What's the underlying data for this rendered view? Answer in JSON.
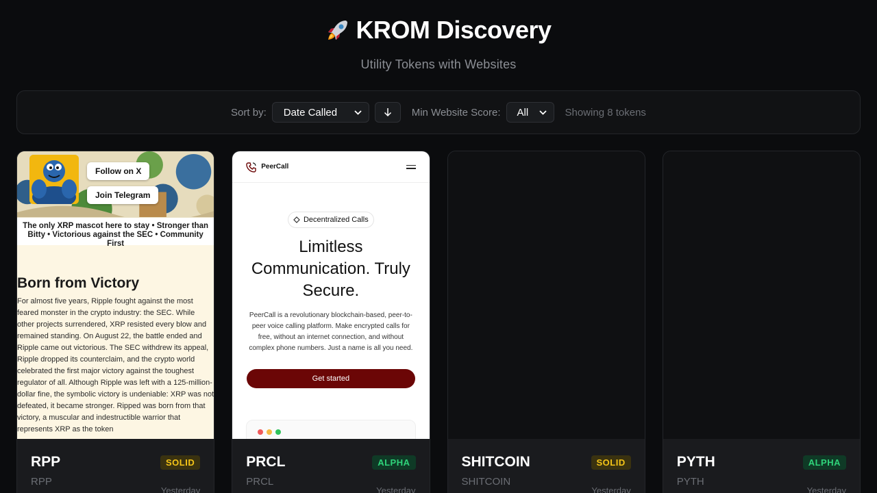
{
  "header": {
    "title": "KROM Discovery",
    "subtitle": "Utility Tokens with Websites"
  },
  "controls": {
    "sort_label": "Sort by:",
    "sort_value": "Date Called",
    "sort_direction_icon": "arrow-down-icon",
    "score_label": "Min Website Score:",
    "score_value": "All",
    "showing_text": "Showing 8 tokens"
  },
  "cards": [
    {
      "ticker": "RPP",
      "sub": "RPP",
      "badge": "SOLID",
      "date": "Yesterday",
      "preview": {
        "buttons": [
          "Follow on X",
          "Join Telegram"
        ],
        "tagline": "The only XRP mascot here to stay • Stronger than Bitty • Victorious against the SEC • Community First",
        "heading": "Born from Victory",
        "paragraph": "For almost five years, Ripple fought against the most feared monster in the crypto industry: the SEC. While other projects surrendered, XRP resisted every blow and remained standing. On August 22, the battle ended and Ripple came out victorious. The SEC withdrew its appeal, Ripple dropped its counterclaim, and the crypto world celebrated the first major victory against the toughest regulator of all. Although Ripple was left with a 125-million-dollar fine, the symbolic victory is undeniable: XRP was not defeated, it became stronger. Ripped was born from that victory, a muscular and indestructible warrior that represents XRP as the token"
      }
    },
    {
      "ticker": "PRCL",
      "sub": "PRCL",
      "badge": "ALPHA",
      "date": "Yesterday",
      "preview": {
        "brand": "PeerCall",
        "pill": "Decentralized Calls",
        "heading": "Limitless Communication. Truly Secure.",
        "paragraph": "PeerCall is a revolutionary blockchain-based, peer-to-peer voice calling platform. Make encrypted calls for free, without an internet connection, and without complex phone numbers. Just a name is all you need.",
        "cta": "Get started"
      }
    },
    {
      "ticker": "SHITCOIN",
      "sub": "SHITCOIN",
      "badge": "SOLID",
      "date": "Yesterday"
    },
    {
      "ticker": "PYTH",
      "sub": "PYTH",
      "badge": "ALPHA",
      "date": "Yesterday"
    }
  ],
  "colors": {
    "background": "#0b0c0e",
    "solid_badge": "#f5c518",
    "alpha_badge": "#2fd37a",
    "prcl_cta": "#6b0606",
    "rpp_logo": "#f2b70f"
  }
}
